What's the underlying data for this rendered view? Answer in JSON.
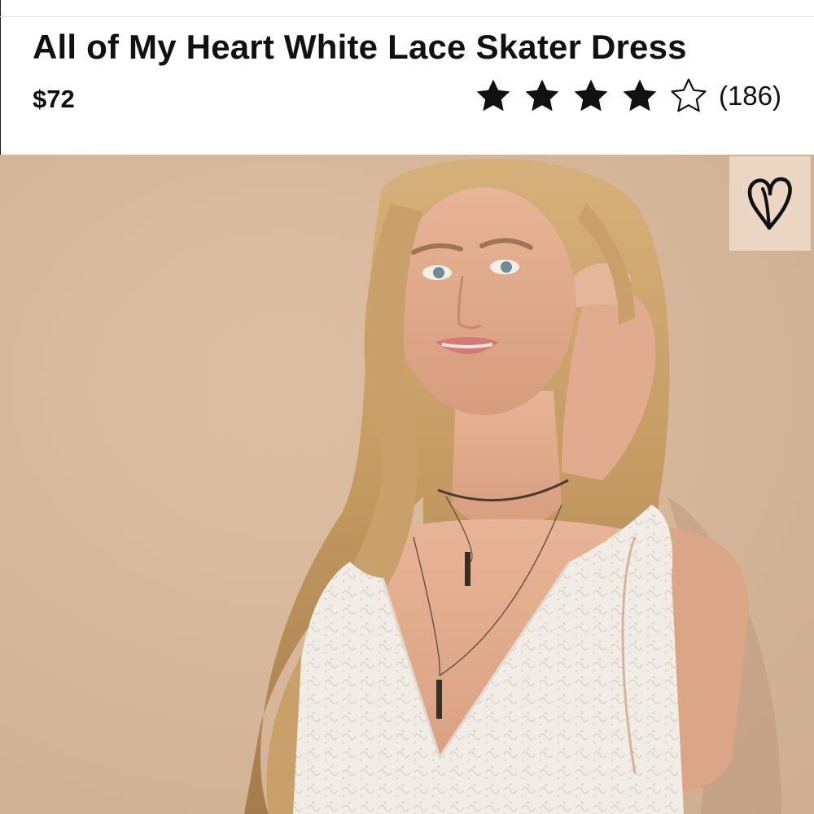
{
  "product": {
    "title": "All of My Heart White Lace Skater Dress",
    "price": "$72",
    "rating": 4,
    "rating_max": 5,
    "review_count": "(186)"
  },
  "icons": {
    "filled_star": "star-filled-icon",
    "empty_star": "star-outline-icon",
    "favorite": "heart-outline-icon"
  },
  "colors": {
    "text": "#111111",
    "backdrop": "#d9b99b",
    "dress": "#f1ece5",
    "fav_bg": "#ecd9c6"
  }
}
